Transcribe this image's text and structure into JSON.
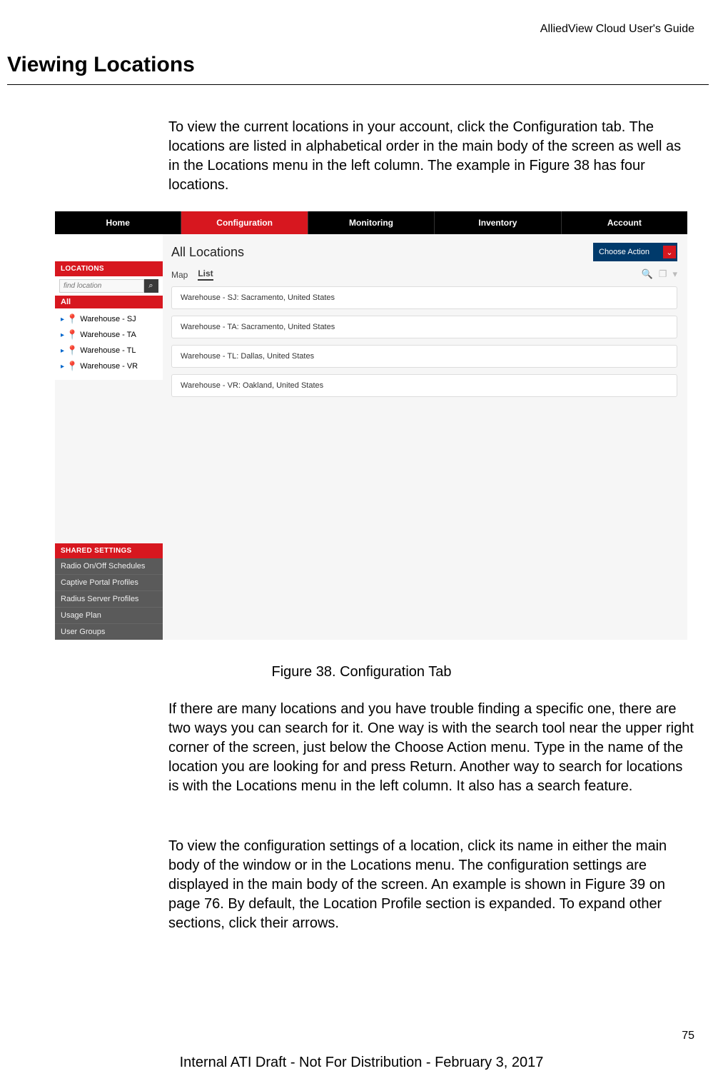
{
  "doc": {
    "guide_title": "AlliedView Cloud User's Guide",
    "section_title": "Viewing Locations",
    "intro": "To view the current locations in your account, click the Configuration tab. The locations are listed in alphabetical order in the main body of the screen as well as in the Locations menu in the left column. The example in Figure 38 has four locations.",
    "figure_caption": "Figure 38. Configuration Tab",
    "para2": "If there are many locations and you have trouble finding a specific one, there are two ways you can search for it. One way is with the search tool near the upper right corner of the screen, just below the Choose Action menu. Type in the name of the location you are looking for and press Return. Another way to search for locations is with the Locations menu in the left column. It also has a search feature.",
    "para3": "To view the configuration settings of a location, click its name in either the main body of the window or in the Locations menu. The configuration settings are displayed in the main body of the screen. An example is shown in Figure 39 on page 76. By default, the Location Profile section is expanded. To expand other sections, click their arrows.",
    "page_number": "75",
    "footer": "Internal ATI Draft - Not For Distribution - February 3, 2017"
  },
  "screenshot": {
    "nav": {
      "tabs": [
        "Home",
        "Configuration",
        "Monitoring",
        "Inventory",
        "Account"
      ],
      "active_index": 1
    },
    "sidebar": {
      "locations_header": "LOCATIONS",
      "search_placeholder": "find location",
      "all_label": "All",
      "items": [
        {
          "label": "Warehouse - SJ"
        },
        {
          "label": "Warehouse - TA"
        },
        {
          "label": "Warehouse - TL"
        },
        {
          "label": "Warehouse - VR"
        }
      ],
      "shared_header": "SHARED SETTINGS",
      "shared_items": [
        "Radio On/Off Schedules",
        "Captive Portal Profiles",
        "Radius Server Profiles",
        "Usage Plan",
        "User Groups"
      ]
    },
    "main": {
      "title": "All Locations",
      "choose_action": "Choose Action",
      "view_map": "Map",
      "view_list": "List",
      "location_rows": [
        "Warehouse - SJ: Sacramento, United States",
        "Warehouse - TA: Sacramento, United States",
        "Warehouse - TL: Dallas, United States",
        "Warehouse - VR: Oakland, United States"
      ]
    }
  }
}
